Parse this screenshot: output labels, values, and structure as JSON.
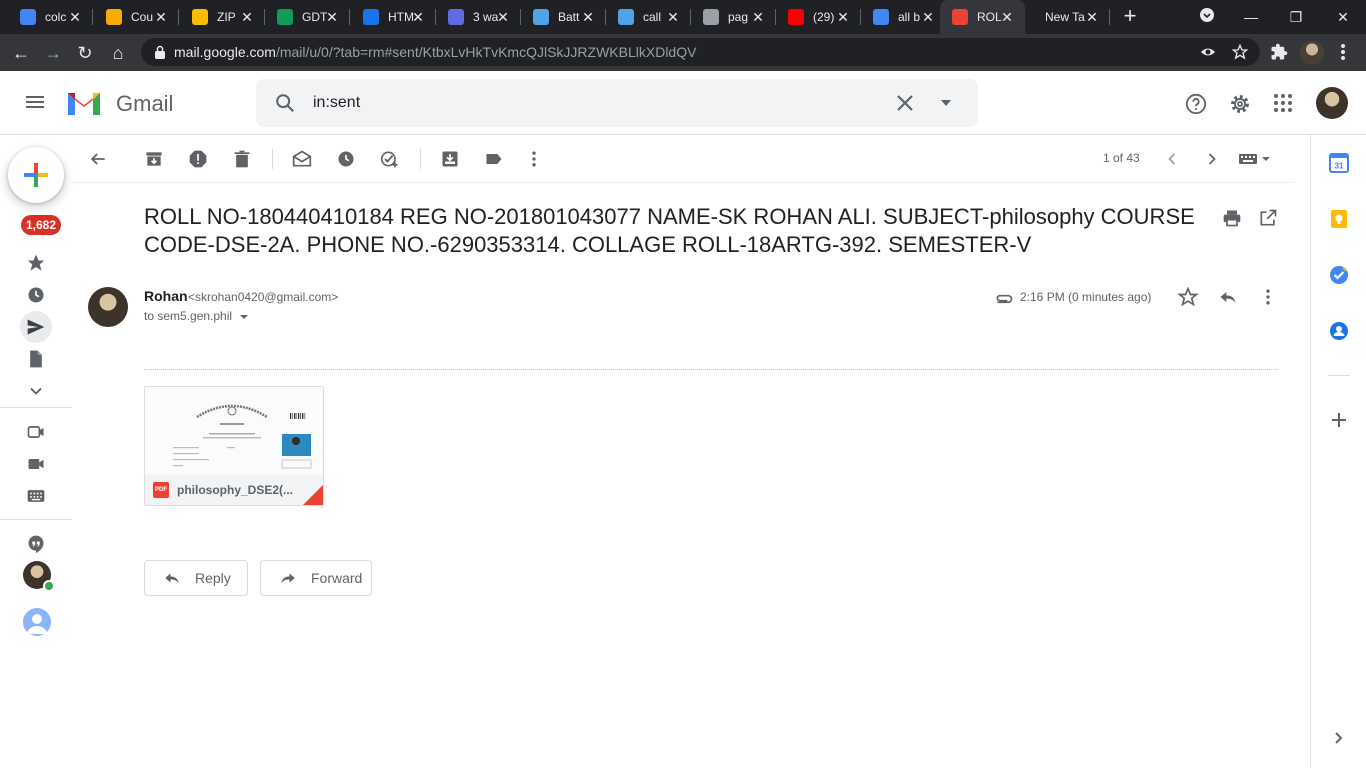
{
  "browser": {
    "tabs": [
      {
        "title": "colc",
        "favicon": "google-icon",
        "color": "#4285f4"
      },
      {
        "title": "Cou",
        "favicon": "classroom-icon",
        "color": "#f9ab00"
      },
      {
        "title": "ZIP",
        "favicon": "zip-icon",
        "color": "#fbbc04"
      },
      {
        "title": "GDT",
        "favicon": "drive-icon",
        "color": "#0f9d58"
      },
      {
        "title": "HTM",
        "favicon": "html-icon",
        "color": "#1a73e8"
      },
      {
        "title": "3 wa",
        "favicon": "canva-icon",
        "color": "#5f6bde"
      },
      {
        "title": "Batt",
        "favicon": "diamond-icon",
        "color": "#4fa3e8"
      },
      {
        "title": "call",
        "favicon": "diamond-icon",
        "color": "#4fa3e8"
      },
      {
        "title": "pag",
        "favicon": "globe-icon",
        "color": "#9aa0a6"
      },
      {
        "title": "(29)",
        "favicon": "youtube-icon",
        "color": "#ff0000"
      },
      {
        "title": "all b",
        "favicon": "google-icon",
        "color": "#4285f4"
      },
      {
        "title": "ROL",
        "favicon": "gmail-icon",
        "color": "#ea4335"
      },
      {
        "title": "New Tab",
        "favicon": "",
        "color": ""
      }
    ],
    "active_tab_index": 11,
    "url_host": "mail.google.com",
    "url_path": "/mail/u/0/?tab=rm#sent/KtbxLvHkTvKmcQJlSkJJRZWKBLlkXDldQV"
  },
  "gmail": {
    "title": "Gmail",
    "search": {
      "value": "in:sent"
    },
    "unread_count": "1,682",
    "pager": "1 of 43",
    "accent": "#d93025"
  },
  "message": {
    "subject": "ROLL NO-180440410184 REG NO-201801043077 NAME-SK ROHAN ALI. SUBJECT-philosophy COURSE CODE-DSE-2A. PHONE NO.-6290353314. COLLAGE ROLL-18ARTG-392. SEMESTER-V",
    "sender_name": "Rohan",
    "sender_email": "<skrohan0420@gmail.com>",
    "to": "to sem5.gen.phil",
    "time": "2:16 PM (0 minutes ago)",
    "attachment": {
      "name": "philosophy_DSE2(...",
      "type": "PDF"
    },
    "reply_label": "Reply",
    "forward_label": "Forward"
  }
}
